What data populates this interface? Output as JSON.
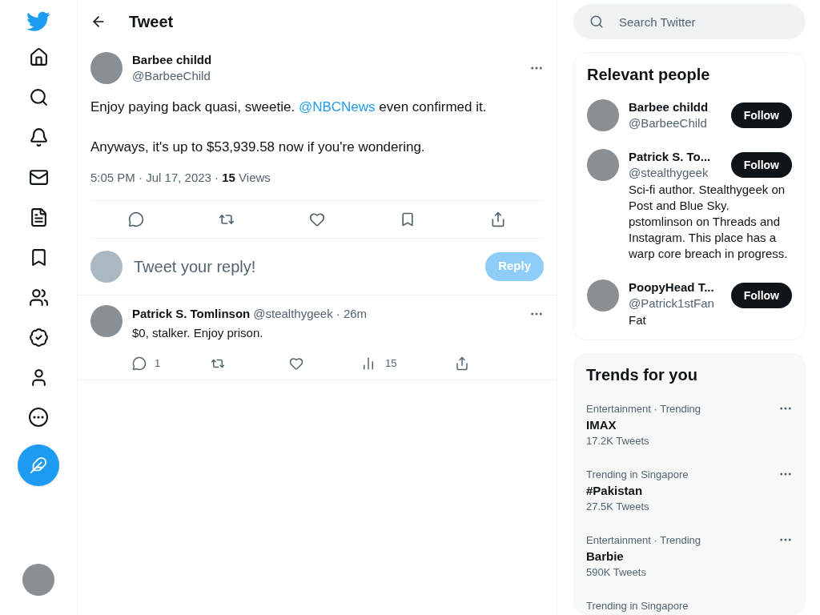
{
  "nav": {
    "items": [
      {
        "kind": "home"
      },
      {
        "kind": "search"
      },
      {
        "kind": "bell"
      },
      {
        "kind": "mail"
      },
      {
        "kind": "list"
      },
      {
        "kind": "bookmark"
      },
      {
        "kind": "people"
      },
      {
        "kind": "verified"
      },
      {
        "kind": "profile"
      },
      {
        "kind": "more"
      }
    ]
  },
  "header": {
    "title": "Tweet"
  },
  "tweet": {
    "name": "Barbee childd",
    "handle": "@BarbeeChild",
    "paragraphs": [
      {
        "before": "Enjoy paying back quasi, sweetie. ",
        "link": "@NBCNews",
        "after": " even confirmed it."
      },
      {
        "before": "Anyways, it's up to $53,939.58 now if you're wondering."
      }
    ],
    "time": "5:05 PM · Jul 17, 2023 · ",
    "views_count": "15",
    "views_label": " Views"
  },
  "reply_box": {
    "placeholder": "Tweet your reply!",
    "button": "Reply",
    "disabled": true
  },
  "replies": [
    {
      "name": "Patrick S. Tomlinson",
      "handle": "@stealthygeek",
      "time": "· 26m",
      "text": "$0, stalker. Enjoy prison.",
      "replies": "1",
      "views": "15"
    }
  ],
  "search": {
    "placeholder": "Search Twitter"
  },
  "people": {
    "title": "Relevant people",
    "items": [
      {
        "name": "Barbee childd",
        "handle": "@BarbeeChild",
        "button": "Follow"
      },
      {
        "name": "Patrick S. To...",
        "handle": "@stealthygeek",
        "bio": "Sci-fi author. Stealthygeek on Post and Blue Sky. pstomlinson on Threads and Instagram. This place has a warp core breach in progress.",
        "button": "Follow"
      },
      {
        "name": "PoopyHead T...",
        "handle": "@Patrick1stFan",
        "bio": "Fat",
        "button": "Follow"
      }
    ]
  },
  "trends": {
    "title": "Trends for you",
    "items": [
      {
        "context": "Entertainment · Trending",
        "name": "IMAX",
        "count": "17.2K Tweets"
      },
      {
        "context": "Trending in Singapore",
        "name": "#Pakistan",
        "count": "27.5K Tweets"
      },
      {
        "context": "Entertainment · Trending",
        "name": "Barbie",
        "count": "590K Tweets"
      },
      {
        "context": "Trending in Singapore"
      }
    ]
  }
}
